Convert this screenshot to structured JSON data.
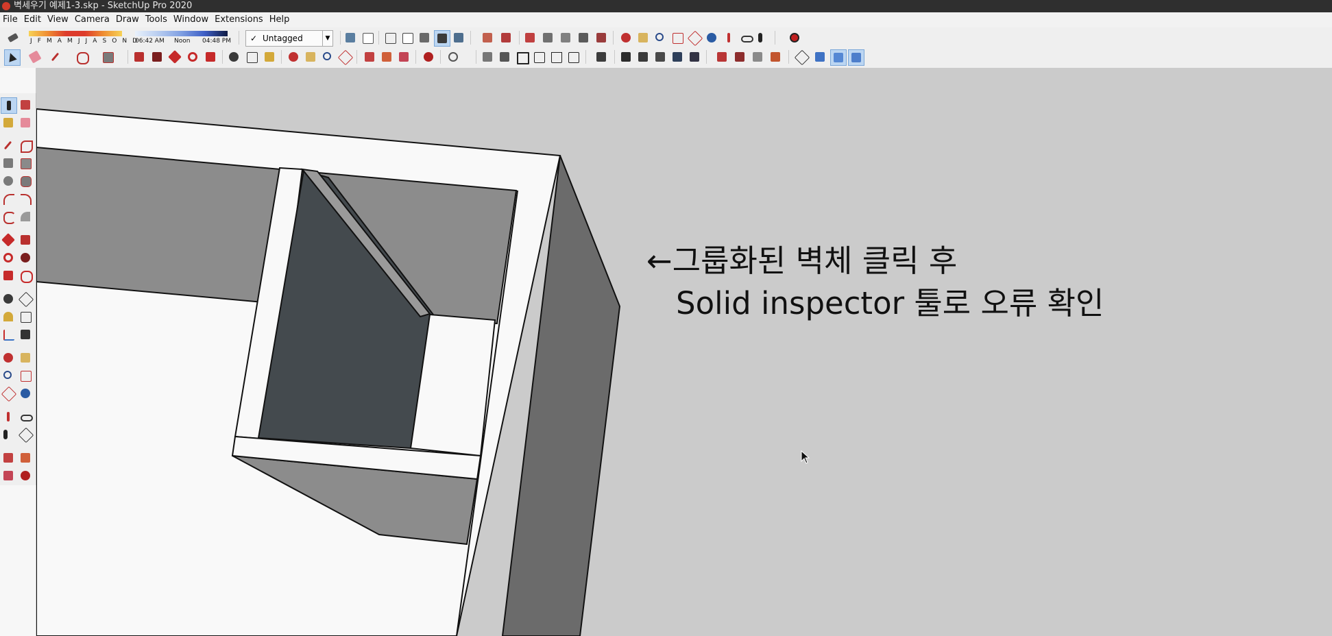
{
  "window": {
    "title": "벽세우기 예제1-3.skp - SketchUp Pro 2020"
  },
  "menu": [
    "File",
    "Edit",
    "View",
    "Camera",
    "Draw",
    "Tools",
    "Window",
    "Extensions",
    "Help"
  ],
  "shadows": {
    "months": "J F M A M J J A S O N D",
    "time_start": "06:42 AM",
    "time_mid": "Noon",
    "time_end": "04:48 PM"
  },
  "tag": {
    "current": "Untagged"
  },
  "annotation": {
    "line1": "←그룹화된 벽체 클릭 후",
    "line2": "Solid inspector 툴로 오류 확인"
  },
  "colors": {
    "viewport_bg": "#cbcbcb",
    "face_light": "#f9f9f9",
    "face_mid": "#8c8c8c",
    "face_dark": "#444a4e",
    "face_side": "#6b6b6b",
    "title_bg": "#2f2f2f"
  },
  "toolbar_icons": {
    "row1": [
      "tag-icon",
      "shadow-settings-icon",
      "face-style-xray-icon",
      "face-style-wireframe-icon",
      "face-style-hidden-icon",
      "face-style-shaded-icon",
      "face-style-textured-icon",
      "face-style-monochrome-icon",
      "warehouse-icon",
      "extension-icon",
      "section-plane-icon",
      "orbit-icon",
      "pan-icon",
      "zoom-icon",
      "zoom-window-icon",
      "zoom-extents-icon",
      "previous-icon",
      "position-camera-icon",
      "look-around-icon",
      "walk-icon",
      "geo-location-icon"
    ],
    "row2": [
      "select-icon",
      "eraser-icon",
      "pencil-icon",
      "arc-icon",
      "rectangle-icon",
      "push-pull-icon",
      "follow-me-icon",
      "move-icon",
      "rotate-icon",
      "scale-icon",
      "tape-icon",
      "text-icon",
      "paint-icon",
      "orbit-icon",
      "pan-icon",
      "zoom-icon",
      "zoom-extents-icon",
      "solid-outer-shell-icon",
      "solid-intersect-icon",
      "solid-union-icon",
      "sandbox-icon",
      "iso-view-icon",
      "top-view-icon",
      "front-view-icon",
      "right-view-icon",
      "back-view-icon",
      "left-view-icon",
      "style-icon",
      "section-icon",
      "component-icon"
    ]
  },
  "left_tools": [
    "select-icon",
    "make-component-icon",
    "paint-bucket-icon",
    "eraser-icon",
    "line-icon",
    "freehand-icon",
    "rectangle-icon",
    "rotated-rectangle-icon",
    "circle-icon",
    "polygon-icon",
    "arc-icon",
    "pie-icon",
    "two-point-arc-icon",
    "three-point-arc-icon",
    "move-icon",
    "push-pull-icon",
    "rotate-icon",
    "follow-me-icon",
    "scale-icon",
    "offset-icon",
    "tape-measure-icon",
    "dimension-icon",
    "protractor-icon",
    "text-icon",
    "axes-icon",
    "3d-text-icon",
    "orbit-icon",
    "pan-icon",
    "zoom-icon",
    "zoom-window-icon",
    "zoom-extents-icon",
    "previous-view-icon",
    "position-camera-icon",
    "look-around-icon",
    "walk-icon",
    "section-plane-icon",
    "solid-tools-icon",
    "outer-shell-icon",
    "intersect-icon",
    "union-icon"
  ]
}
